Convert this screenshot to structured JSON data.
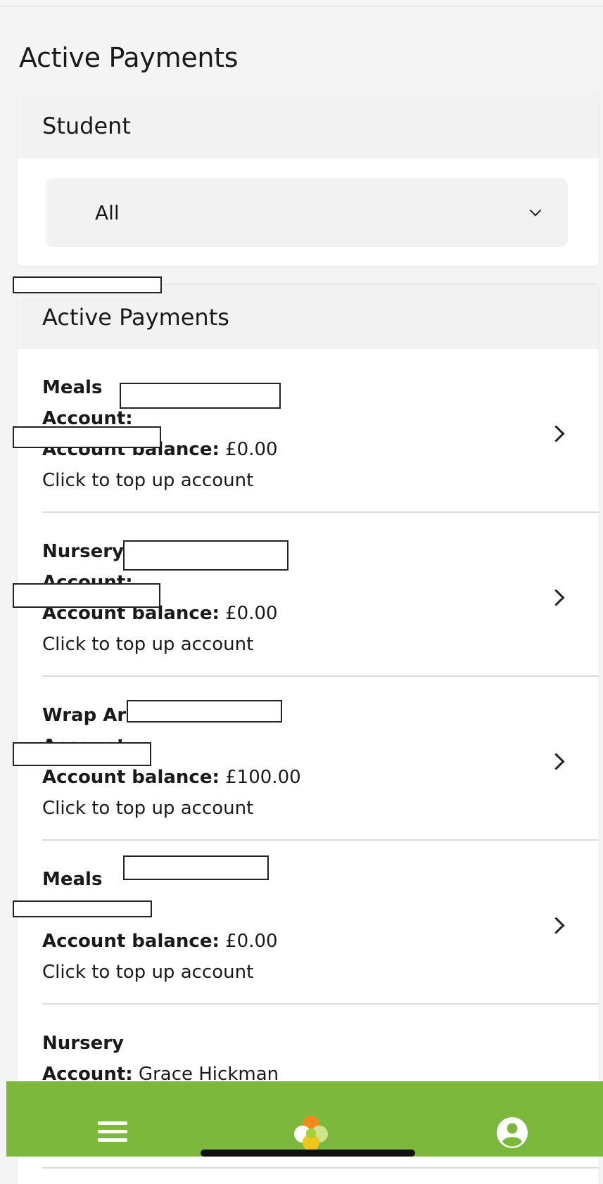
{
  "page": {
    "title": "Active Payments"
  },
  "student_filter": {
    "header": "Student",
    "selected": "All"
  },
  "payments": {
    "header": "Active Payments",
    "account_label": "Account:",
    "balance_label": "Account balance:",
    "top_up_text": "Click to top up account",
    "items": [
      {
        "name": "Meals",
        "account": "",
        "balance": "£0.00"
      },
      {
        "name": "Nursery",
        "account": "",
        "balance": "£0.00"
      },
      {
        "name": "Wrap Around Care",
        "account": "",
        "balance": "£100.00"
      },
      {
        "name": "Meals",
        "account": "",
        "balance": "£0.00"
      },
      {
        "name": "Nursery",
        "account": "Grace Hickman",
        "balance": ""
      }
    ]
  },
  "bottom_nav": {
    "background": "#7cb83c",
    "icons": [
      "menu-icon",
      "logo-icon",
      "profile-icon"
    ]
  }
}
